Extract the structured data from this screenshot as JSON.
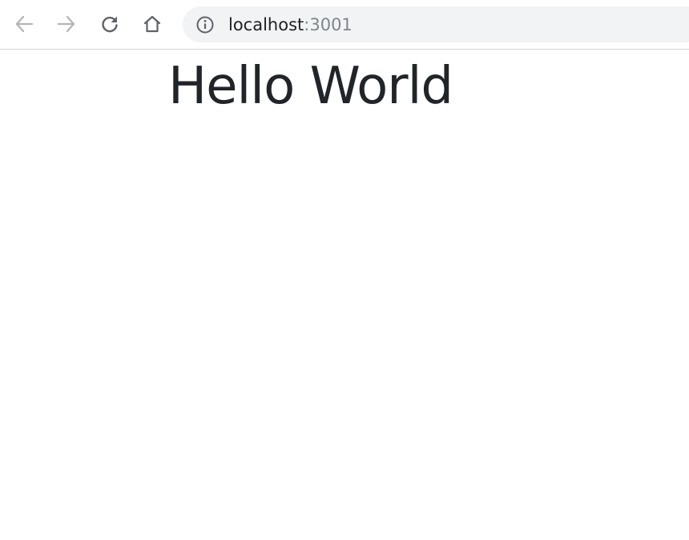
{
  "browser": {
    "address_bar": {
      "host": "localhost",
      "port": ":3001"
    },
    "icons": {
      "back": "back-arrow-icon",
      "forward": "forward-arrow-icon",
      "reload": "reload-icon",
      "home": "home-icon",
      "site_info": "info-icon"
    },
    "colors": {
      "toolbar_bg": "#ffffff",
      "omnibox_bg": "#f1f3f4",
      "icon_disabled": "#b4b4b4",
      "icon_active": "#5f6368"
    }
  },
  "page": {
    "heading": "Hello World",
    "heading_color": "#212529"
  }
}
